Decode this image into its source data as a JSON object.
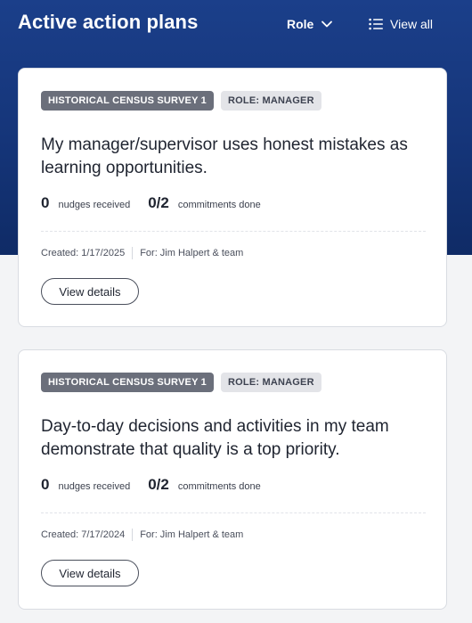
{
  "header": {
    "title": "Active action plans",
    "role_filter_label": "Role",
    "view_all_label": "View all"
  },
  "plans": [
    {
      "survey_tag": "HISTORICAL CENSUS SURVEY 1",
      "role_tag": "ROLE: MANAGER",
      "title": "My manager/supervisor uses honest mistakes as learning opportunities.",
      "nudges_count": "0",
      "nudges_label": "nudges received",
      "commitments_count": "0/2",
      "commitments_label": "commitments done",
      "created": "Created: 1/17/2025",
      "for": "For: Jim Halpert  & team",
      "details_label": "View details"
    },
    {
      "survey_tag": "HISTORICAL CENSUS SURVEY 1",
      "role_tag": "ROLE: MANAGER",
      "title": "Day-to-day decisions and activities in my team demonstrate that quality is a top priority.",
      "nudges_count": "0",
      "nudges_label": "nudges received",
      "commitments_count": "0/2",
      "commitments_label": "commitments done",
      "created": "Created: 7/17/2024",
      "for": "For: Jim Halpert  & team",
      "details_label": "View details"
    }
  ],
  "icons": {
    "role_dropdown": "chevron-down-icon",
    "view_all": "list-icon"
  },
  "colors": {
    "hero_background": "#153579",
    "survey_tag": "#6b6f7b",
    "role_tag": "#e3e4e8"
  }
}
